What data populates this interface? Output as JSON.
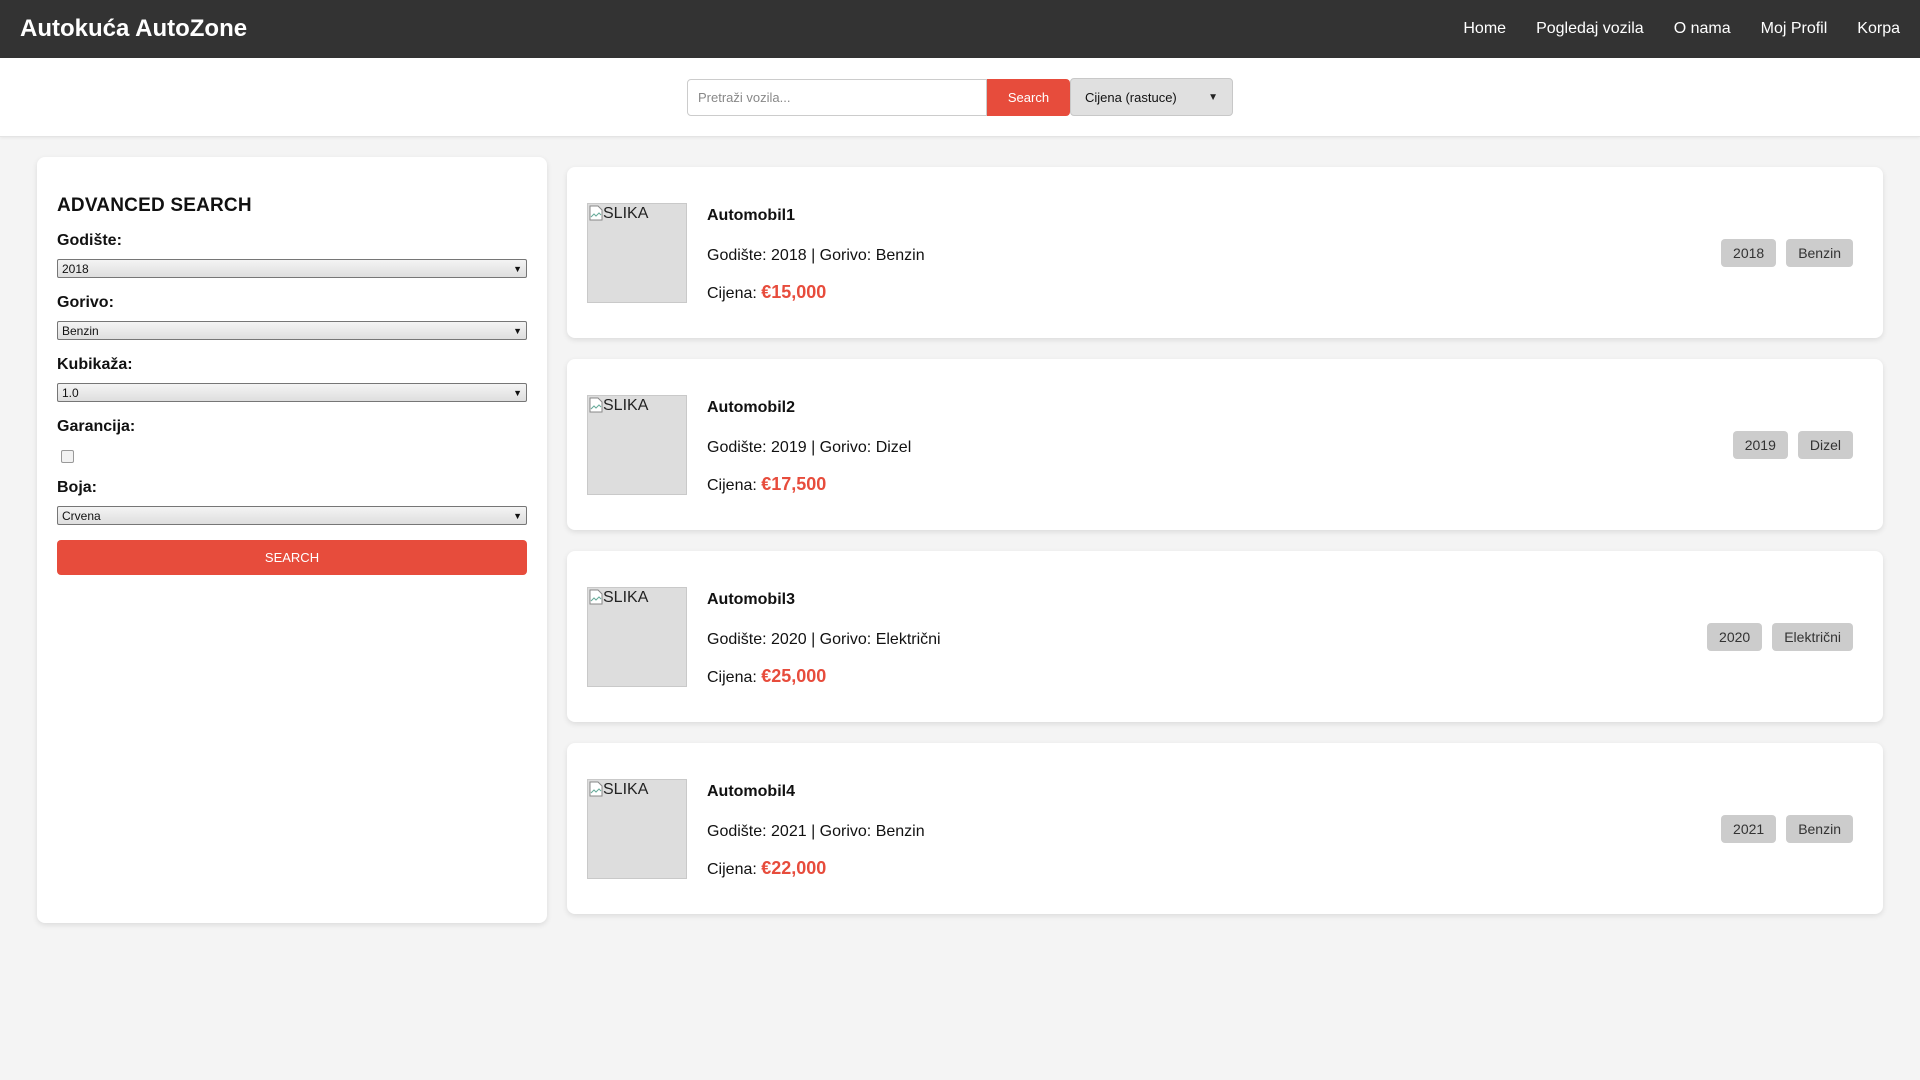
{
  "header": {
    "brand": "Autokuća AutoZone",
    "nav": [
      "Home",
      "Pogledaj vozila",
      "O nama",
      "Moj Profil",
      "Korpa"
    ]
  },
  "search": {
    "placeholder": "Pretraži vozila...",
    "button_label": "Search",
    "sort_selected": "Cijena (rastuce)"
  },
  "advanced": {
    "title": "ADVANCED SEARCH",
    "year_label": "Godište:",
    "year_value": "2018",
    "fuel_label": "Gorivo:",
    "fuel_value": "Benzin",
    "engine_label": "Kubikaža:",
    "engine_value": "1.0",
    "warranty_label": "Garancija:",
    "warranty_checked": false,
    "color_label": "Boja:",
    "color_value": "Crvena",
    "button_label": "SEARCH"
  },
  "listings": [
    {
      "image_alt": "SLIKA",
      "title": "Automobil1",
      "meta": "Godište: 2018 | Gorivo: Benzin",
      "price_label": "Cijena: ",
      "price": "€15,000",
      "tags": [
        "2018",
        "Benzin"
      ]
    },
    {
      "image_alt": "SLIKA",
      "title": "Automobil2",
      "meta": "Godište: 2019 | Gorivo: Dizel",
      "price_label": "Cijena: ",
      "price": "€17,500",
      "tags": [
        "2019",
        "Dizel"
      ]
    },
    {
      "image_alt": "SLIKA",
      "title": "Automobil3",
      "meta": "Godište: 2020 | Gorivo: Električni",
      "price_label": "Cijena: ",
      "price": "€25,000",
      "tags": [
        "2020",
        "Električni"
      ]
    },
    {
      "image_alt": "SLIKA",
      "title": "Automobil4",
      "meta": "Godište: 2021 | Gorivo: Benzin",
      "price_label": "Cijena: ",
      "price": "€22,000",
      "tags": [
        "2021",
        "Benzin"
      ]
    }
  ],
  "colors": {
    "accent": "#e74c3c",
    "header_bg": "#333333",
    "page_bg": "#f4f4f4",
    "tag_bg": "#cccccc"
  }
}
